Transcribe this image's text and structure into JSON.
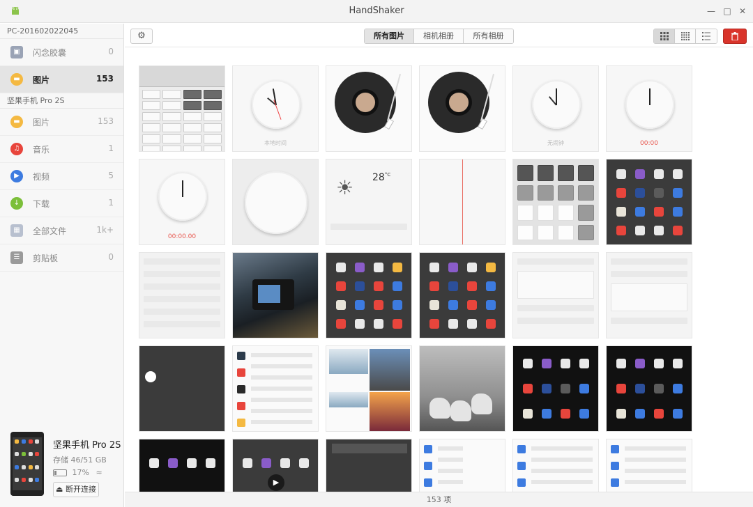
{
  "window": {
    "title": "HandShaker"
  },
  "sidebar": {
    "pc_group": {
      "header": "PC-201602022045",
      "items": [
        {
          "label": "闪念胶囊",
          "count": "0",
          "icon": "capsule-icon",
          "color": "#9aa3b5"
        },
        {
          "label": "图片",
          "count": "153",
          "icon": "image-icon",
          "color": "#f4b942"
        }
      ]
    },
    "phone_group": {
      "header": "坚果手机 Pro 2S",
      "items": [
        {
          "label": "图片",
          "count": "153",
          "icon": "image-icon",
          "color": "#f4b942"
        },
        {
          "label": "音乐",
          "count": "1",
          "icon": "music-icon",
          "color": "#e8453c"
        },
        {
          "label": "视频",
          "count": "5",
          "icon": "video-icon",
          "color": "#3d7be0"
        },
        {
          "label": "下载",
          "count": "1",
          "icon": "download-icon",
          "color": "#7cbf3a"
        },
        {
          "label": "全部文件",
          "count": "1k+",
          "icon": "files-icon",
          "color": "#9aa3b5"
        },
        {
          "label": "剪贴板",
          "count": "0",
          "icon": "clipboard-icon",
          "color": "#9a9a9a"
        }
      ]
    },
    "device": {
      "name": "坚果手机 Pro 2S",
      "storage": "存储 46/51 GB",
      "battery": "17%",
      "disconnect_label": "断开连接"
    }
  },
  "toolbar": {
    "tabs": [
      "所有图片",
      "相机相册",
      "所有相册"
    ],
    "active_tab": "所有图片"
  },
  "gallery": {
    "captions": {
      "world_clock": "本地时间",
      "alarm": "无闹钟",
      "timer": "00:00",
      "stopwatch": "00:00.00",
      "weather_temp": "28",
      "weather_unit": "°C"
    }
  },
  "status": {
    "count_text": "153 项"
  },
  "colors": {
    "accent_red": "#d9342b",
    "sidebar_bg": "#f7f7f7"
  }
}
